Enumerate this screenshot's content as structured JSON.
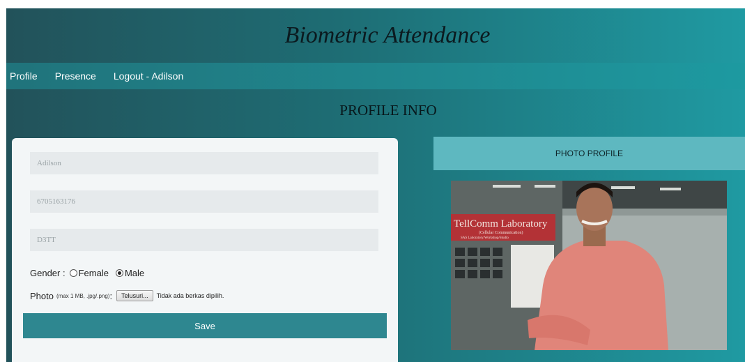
{
  "app": {
    "title": "Biometric Attendance"
  },
  "nav": {
    "items": [
      {
        "label": "Profile"
      },
      {
        "label": "Presence"
      },
      {
        "label": "Logout - Adilson"
      }
    ]
  },
  "page": {
    "section_title": "PROFILE INFO"
  },
  "form": {
    "name_value": "Adilson",
    "id_value": "6705163176",
    "class_value": "D3TT",
    "gender_label": "Gender :",
    "gender_options": [
      {
        "label": "Female",
        "checked": false
      },
      {
        "label": "Male",
        "checked": true
      }
    ],
    "photo_label": "Photo",
    "photo_hint": "(max 1 MB, .jpg/.png)",
    "photo_colon": ":",
    "browse_label": "Telusuri...",
    "file_status": "Tidak ada berkas dipilih.",
    "save_label": "Save"
  },
  "photo_panel": {
    "header": "PHOTO PROFILE",
    "sign_title": "TellComm Laboratory",
    "sign_sub1": "(Cellular Communication)",
    "sign_sub2": "SAS Laboratory/Workshop/Studio"
  },
  "colors": {
    "header_bg_start": "#22525a",
    "header_bg_end": "#1f9aa2",
    "save_button": "#2e8790",
    "photo_header": "#5eb8c0"
  }
}
